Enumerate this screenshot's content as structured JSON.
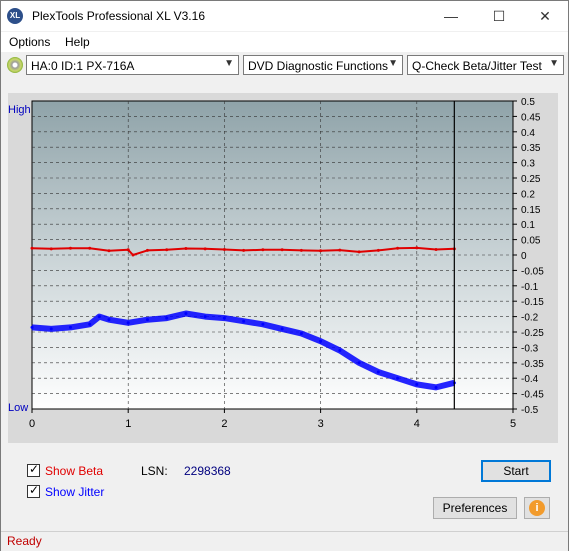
{
  "app": {
    "title": "PlexTools Professional XL V3.16",
    "icon_text": "XL"
  },
  "window_controls": {
    "minimize": "—",
    "maximize": "☐",
    "close": "✕"
  },
  "menu": [
    {
      "label": "Options"
    },
    {
      "label": "Help"
    }
  ],
  "toolbar": {
    "drive": "HA:0 ID:1  PX-716A",
    "function": "DVD Diagnostic Functions",
    "test": "Q-Check Beta/Jitter Test"
  },
  "chart_data": {
    "type": "line",
    "left_axis": {
      "top_label": "High",
      "bottom_label": "Low"
    },
    "right_axis": {
      "range": [
        -0.5,
        0.5
      ],
      "ticks": [
        "0.5",
        "0.45",
        "0.4",
        "0.35",
        "0.3",
        "0.25",
        "0.2",
        "0.15",
        "0.1",
        "0.05",
        "0",
        "-0.05",
        "-0.1",
        "-0.15",
        "-0.2",
        "-0.25",
        "-0.3",
        "-0.35",
        "-0.4",
        "-0.45",
        "-0.5"
      ]
    },
    "x_axis": {
      "range": [
        0,
        5
      ],
      "ticks": [
        "0",
        "1",
        "2",
        "3",
        "4",
        "5"
      ]
    },
    "marker_x": 4.39,
    "colors": {
      "beta": "#e00000",
      "jitter": "#0000ff",
      "marker": "#000000"
    },
    "series": [
      {
        "id": "beta",
        "x": [
          0,
          0.2,
          0.4,
          0.6,
          0.8,
          1.0,
          1.05,
          1.2,
          1.4,
          1.6,
          1.8,
          2.0,
          2.2,
          2.4,
          2.6,
          2.8,
          3.0,
          3.2,
          3.4,
          3.6,
          3.8,
          4.0,
          4.2,
          4.39
        ],
        "y": [
          0.022,
          0.02,
          0.022,
          0.022,
          0.014,
          0.017,
          0.0,
          0.015,
          0.017,
          0.021,
          0.02,
          0.018,
          0.015,
          0.017,
          0.017,
          0.015,
          0.014,
          0.016,
          0.01,
          0.015,
          0.022,
          0.023,
          0.018,
          0.02
        ]
      },
      {
        "id": "jitter",
        "x": [
          0,
          0.2,
          0.4,
          0.6,
          0.7,
          0.8,
          1.0,
          1.2,
          1.4,
          1.6,
          1.8,
          2.0,
          2.2,
          2.4,
          2.6,
          2.8,
          3.0,
          3.2,
          3.4,
          3.6,
          3.8,
          4.0,
          4.2,
          4.39
        ],
        "y": [
          -0.235,
          -0.24,
          -0.235,
          -0.225,
          -0.2,
          -0.21,
          -0.22,
          -0.21,
          -0.205,
          -0.19,
          -0.2,
          -0.205,
          -0.215,
          -0.225,
          -0.24,
          -0.255,
          -0.28,
          -0.31,
          -0.35,
          -0.38,
          -0.4,
          -0.42,
          -0.43,
          -0.415
        ]
      }
    ]
  },
  "controls": {
    "show_beta": {
      "label": "Show Beta",
      "checked": true
    },
    "show_jitter": {
      "label": "Show Jitter",
      "checked": true
    },
    "lsn_label": "LSN:",
    "lsn_value": "2298368",
    "start_button": "Start",
    "preferences_button": "Preferences",
    "info_icon_text": "i"
  },
  "status": {
    "text": "Ready"
  }
}
